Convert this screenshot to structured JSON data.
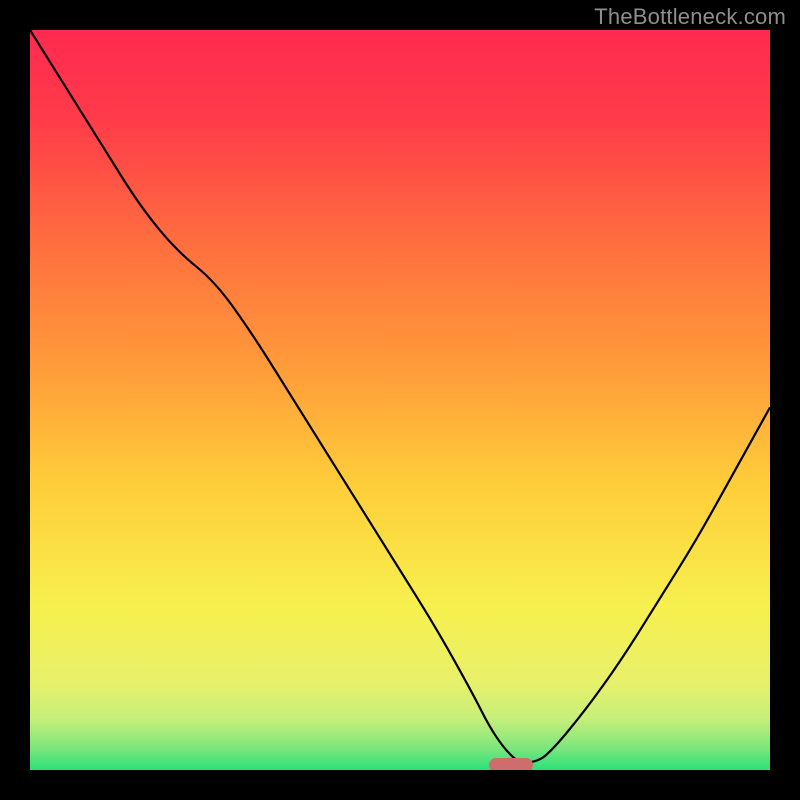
{
  "watermark": "TheBottleneck.com",
  "chart_data": {
    "type": "line",
    "title": "",
    "xlabel": "",
    "ylabel": "",
    "xlim": [
      0,
      100
    ],
    "ylim": [
      0,
      100
    ],
    "x": [
      0,
      5,
      10,
      15,
      20,
      25,
      30,
      35,
      40,
      45,
      50,
      55,
      60,
      62,
      64,
      66,
      68,
      70,
      75,
      80,
      85,
      90,
      95,
      100
    ],
    "values": [
      100,
      92,
      84,
      76,
      70,
      66,
      59,
      51,
      43,
      35,
      27,
      19,
      10,
      6,
      3,
      1,
      1,
      2,
      8,
      15,
      23,
      31,
      40,
      49
    ],
    "marker": {
      "x_start": 62,
      "x_end": 68,
      "y": 0,
      "color": "#cf6d6c"
    },
    "colors": {
      "gradient_top": "#ff2a4f",
      "gradient_mid_upper": "#ff8a3a",
      "gradient_mid": "#ffd23a",
      "gradient_lower": "#f6f56a",
      "gradient_bottom": "#2be07a",
      "curve": "#000000",
      "frame": "#000000"
    }
  }
}
